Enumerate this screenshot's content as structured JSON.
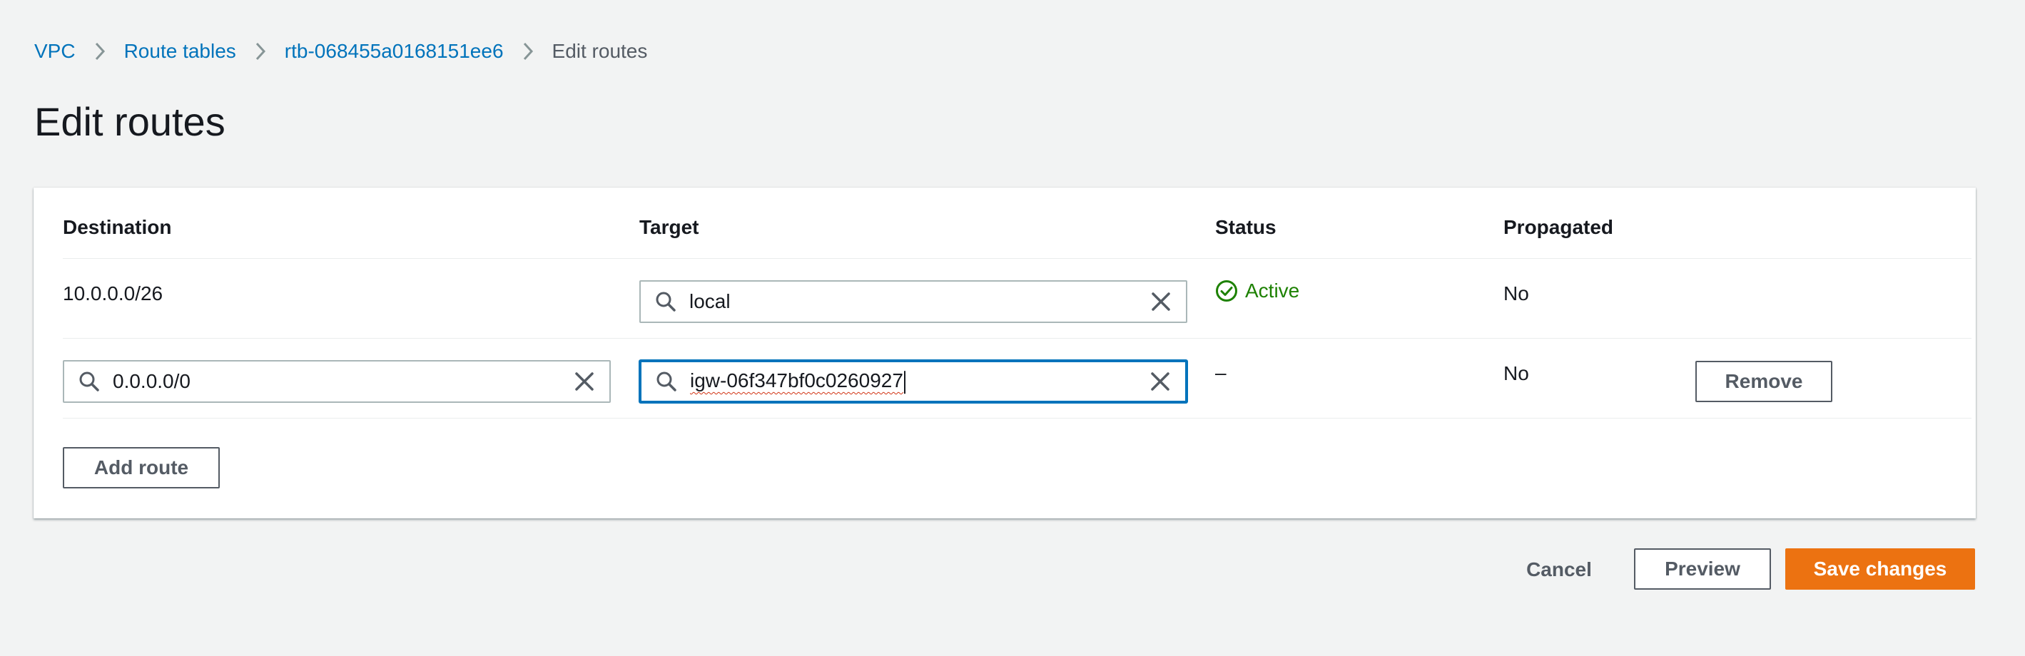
{
  "breadcrumb": {
    "items": [
      "VPC",
      "Route tables",
      "rtb-068455a0168151ee6"
    ],
    "current": "Edit routes"
  },
  "page_title": "Edit routes",
  "table": {
    "headers": {
      "destination": "Destination",
      "target": "Target",
      "status": "Status",
      "propagated": "Propagated"
    },
    "rows": [
      {
        "destination": "10.0.0.0/26",
        "target": "local",
        "status": "Active",
        "propagated": "No"
      },
      {
        "destination": "0.0.0.0/0",
        "target": "igw-06f347bf0c0260927",
        "status": "–",
        "propagated": "No",
        "remove_label": "Remove"
      }
    ]
  },
  "add_route_label": "Add route",
  "footer": {
    "cancel_label": "Cancel",
    "preview_label": "Preview",
    "save_label": "Save changes"
  },
  "colors": {
    "link": "#0073bb",
    "active_status": "#1d8102",
    "primary_button": "#ec7211",
    "focus_border": "#0073bb",
    "background": "#f2f3f3"
  },
  "icons": {
    "breadcrumb_separator": "chevron-right-icon",
    "search": "search-icon",
    "clear": "close-icon",
    "status_active": "check-circle-icon"
  }
}
